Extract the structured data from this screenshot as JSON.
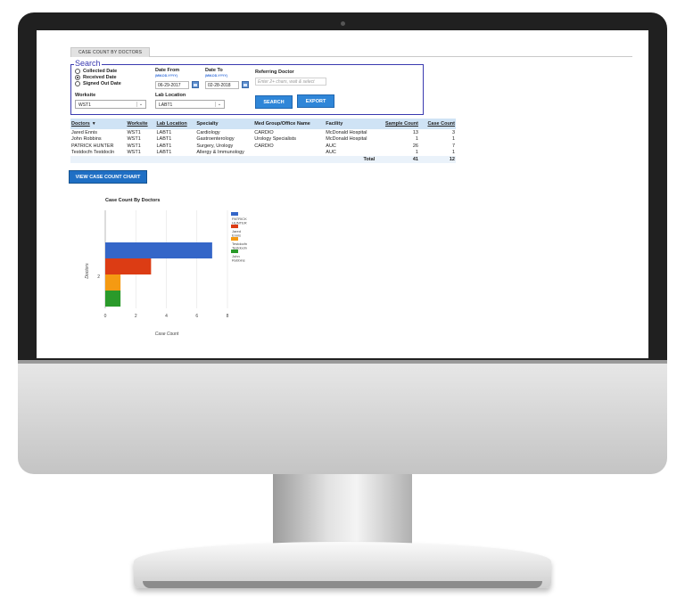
{
  "app": {
    "tab_label": "CASE COUNT BY DOCTORS"
  },
  "search": {
    "legend": "Search",
    "date_type_options": [
      {
        "label": "Collected Date",
        "checked": false
      },
      {
        "label": "Received Date",
        "checked": true
      },
      {
        "label": "Signed Out Date",
        "checked": false
      }
    ],
    "date_from_label": "Date From",
    "date_from_format": "(MM-DD-YYYY)",
    "date_from_value": "06-29-2017",
    "date_to_label": "Date To",
    "date_to_format": "(MM-DD-YYYY)",
    "date_to_value": "02-28-2018",
    "referring_doctor_label": "Referring Doctor",
    "referring_doctor_placeholder": "Enter 2+ chars, wait & select",
    "worksite_label": "Worksite",
    "worksite_value": "WST1",
    "lab_location_label": "Lab Location",
    "lab_location_value": "LABT1",
    "search_button": "SEARCH",
    "export_button": "EXPORT"
  },
  "table": {
    "columns": [
      "Doctors",
      "Worksite",
      "Lab Location",
      "Specialty",
      "Med Group/Office Name",
      "Facility",
      "Sample Count",
      "Case Count"
    ],
    "rows": [
      [
        "Jared Ennis",
        "WST1",
        "LABT1",
        "Cardiology",
        "CARDIO",
        "McDonald Hospital",
        "13",
        "3"
      ],
      [
        "John Robbins",
        "WST1",
        "LABT1",
        "Gastroenterology",
        "Urology Specialists",
        "McDonald Hospital",
        "1",
        "1"
      ],
      [
        "PATRICK HUNTER",
        "WST1",
        "LABT1",
        "Surgery, Urology",
        "CARDIO",
        "AUC",
        "26",
        "7"
      ],
      [
        "Testdocfn Testdocln",
        "WST1",
        "LABT1",
        "Allergy & Immunology",
        "",
        "AUC",
        "1",
        "1"
      ]
    ],
    "total_label": "Total",
    "total_sample_count": "41",
    "total_case_count": "12"
  },
  "chart_button": "VIEW CASE COUNT CHART",
  "chart_data": {
    "type": "bar",
    "orientation": "horizontal",
    "title": "Case Count By Doctors",
    "xlabel": "Case Count",
    "ylabel": "Doctors",
    "y_tick_label": "2",
    "xlim": [
      0,
      8
    ],
    "x_ticks": [
      "0",
      "2",
      "4",
      "6",
      "8"
    ],
    "series": [
      {
        "name": "PATRICK HUNTER",
        "value": 7,
        "color": "#3466c8"
      },
      {
        "name": "Jared Ennis",
        "value": 3,
        "color": "#dc3c14"
      },
      {
        "name": "Testdocfn Testdocln",
        "value": 1,
        "color": "#f59a12"
      },
      {
        "name": "John Robbins",
        "value": 1,
        "color": "#2a9a2a"
      }
    ],
    "legend_position": "right"
  }
}
